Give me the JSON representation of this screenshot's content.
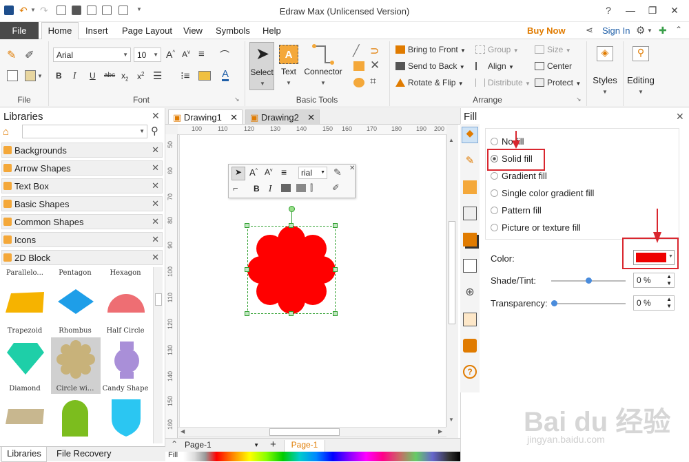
{
  "app": {
    "title": "Edraw Max (Unlicensed Version)"
  },
  "menu": {
    "file": "File",
    "items": [
      "Home",
      "Insert",
      "Page Layout",
      "View",
      "Symbols",
      "Help"
    ],
    "buy_now": "Buy Now",
    "sign_in": "Sign In"
  },
  "ribbon": {
    "groups": {
      "file": "File",
      "font": "Font",
      "basic_tools": "Basic Tools",
      "arrange": "Arrange"
    },
    "font_name": "Arial",
    "font_size": "10",
    "tools": {
      "select": "Select",
      "text": "Text",
      "connector": "Connector"
    },
    "arrange": {
      "bring_to_front": "Bring to Front",
      "send_to_back": "Send to Back",
      "rotate_flip": "Rotate & Flip",
      "group": "Group",
      "align": "Align",
      "distribute": "Distribute",
      "size": "Size",
      "center": "Center",
      "protect": "Protect"
    },
    "styles": "Styles",
    "editing": "Editing"
  },
  "libraries": {
    "title": "Libraries",
    "categories": [
      "Backgrounds",
      "Arrow Shapes",
      "Text Box",
      "Basic Shapes",
      "Common Shapes",
      "Icons",
      "2D Block"
    ],
    "shape_names_top": [
      "Parallelo...",
      "Pentagon",
      "Hexagon"
    ],
    "shapes_row1": [
      "Trapezoid",
      "Rhombus",
      "Half Circle"
    ],
    "shapes_row2": [
      "Diamond",
      "Circle wi...",
      "Candy Shape"
    ],
    "tabs": [
      "Libraries",
      "File Recovery"
    ]
  },
  "tabs": [
    "Drawing1",
    "Drawing2"
  ],
  "rulers": {
    "h": [
      "100",
      "110",
      "120",
      "130",
      "140",
      "150",
      "160",
      "170",
      "180",
      "190",
      "200"
    ],
    "v": [
      "50",
      "60",
      "70",
      "80",
      "90",
      "100",
      "110",
      "120",
      "130",
      "140",
      "150",
      "160"
    ]
  },
  "mini_toolbar": {
    "font": "rial"
  },
  "fill_panel": {
    "title": "Fill",
    "options": [
      "No fill",
      "Solid fill",
      "Gradient fill",
      "Single color gradient fill",
      "Pattern fill",
      "Picture or texture fill"
    ],
    "selected_index": 1,
    "color_label": "Color:",
    "color_value": "#ee0000",
    "shade_label": "Shade/Tint:",
    "shade_value": "0 %",
    "shade_level": 0.5,
    "transparency_label": "Transparency:",
    "transparency_value": "0 %",
    "transparency_level": 0
  },
  "bottom": {
    "page_select": "Page-1",
    "page_tab": "Page-1",
    "fill_label": "Fill"
  },
  "watermark": {
    "main": "Bai du 经验",
    "sub": "jingyan.baidu.com"
  },
  "colors": {
    "accent_red": "#d9262e",
    "shape_fill": "#ff0000",
    "buy_now": "#e07b00",
    "sign_in": "#1f5fa8"
  }
}
